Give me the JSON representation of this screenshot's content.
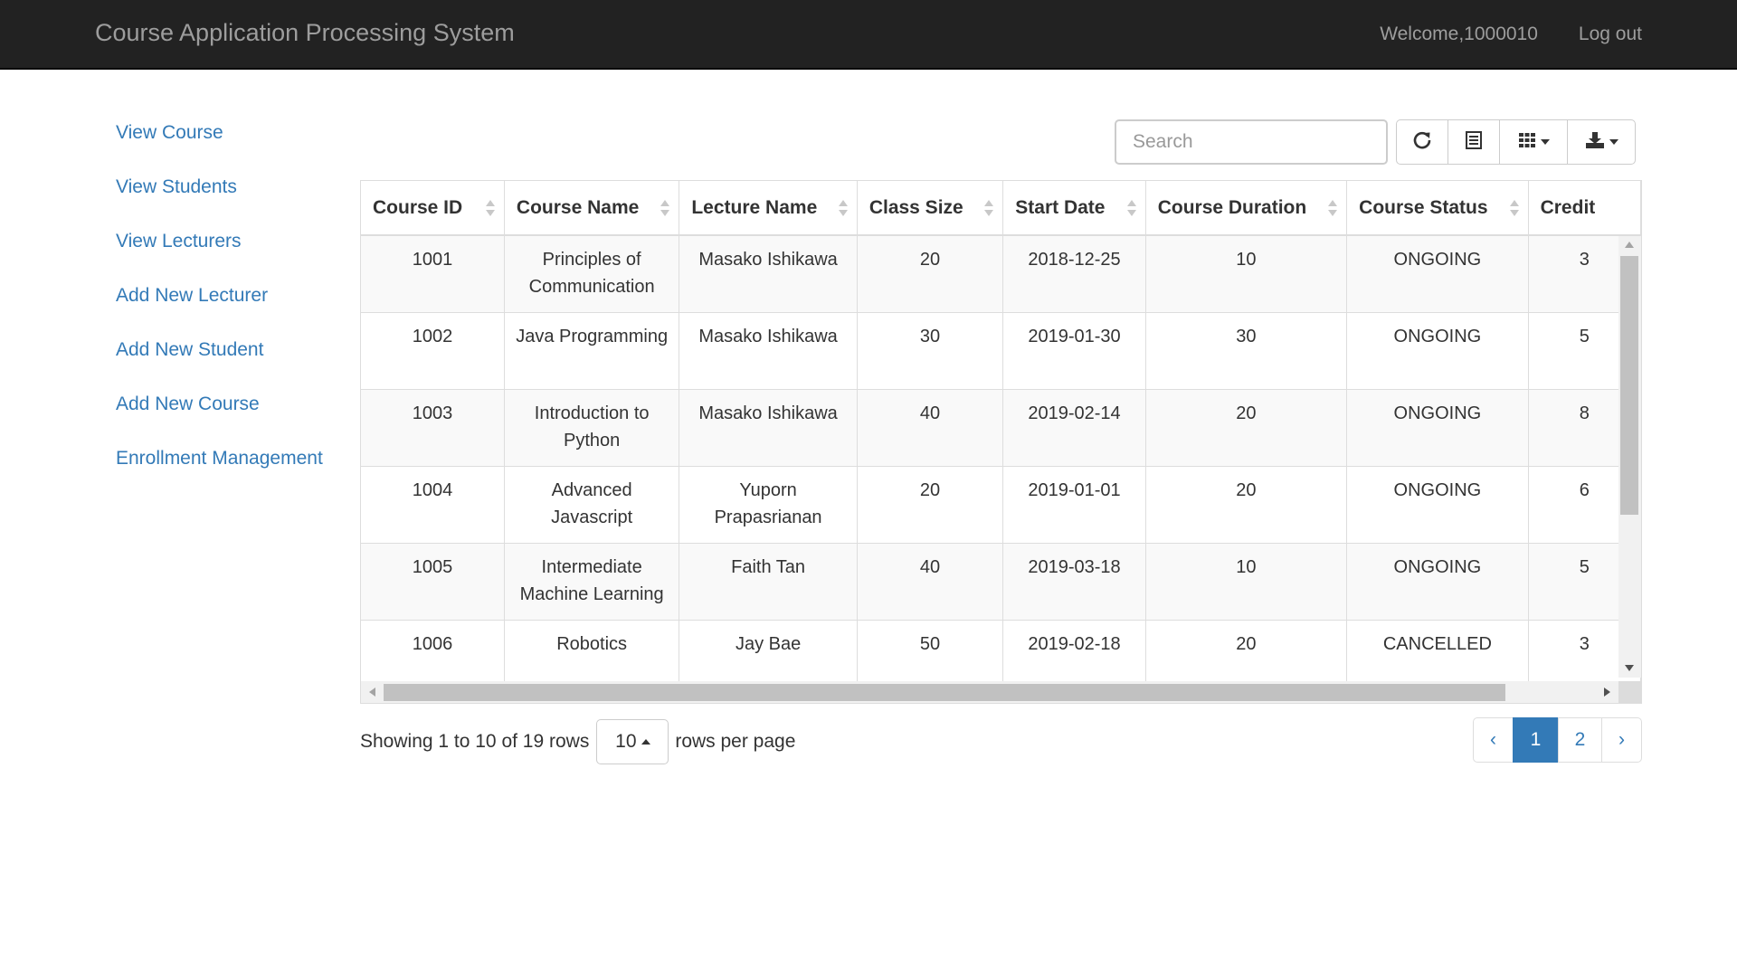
{
  "app": {
    "brand": "Course Application Processing System",
    "welcome": "Welcome,1000010",
    "logout": "Log out"
  },
  "sidebar": {
    "items": [
      {
        "label": "View Course"
      },
      {
        "label": "View Students"
      },
      {
        "label": "View Lecturers"
      },
      {
        "label": "Add New Lecturer"
      },
      {
        "label": "Add New Student"
      },
      {
        "label": "Add New Course"
      },
      {
        "label": "Enrollment Management"
      }
    ]
  },
  "toolbar": {
    "search_placeholder": "Search",
    "buttons": [
      {
        "icon": "refresh-icon"
      },
      {
        "icon": "list-view-icon"
      },
      {
        "icon": "columns-grid-icon"
      },
      {
        "icon": "export-icon"
      }
    ]
  },
  "table": {
    "columns": [
      "Course ID",
      "Course Name",
      "Lecture Name",
      "Class Size",
      "Start Date",
      "Course Duration",
      "Course Status",
      "Credit"
    ],
    "rows": [
      {
        "id": "1001",
        "name": "Principles of Communication",
        "lecturer": "Masako Ishikawa",
        "size": "20",
        "start": "2018-12-25",
        "duration": "10",
        "status": "ONGOING",
        "credit": "3"
      },
      {
        "id": "1002",
        "name": "Java Programming",
        "lecturer": "Masako Ishikawa",
        "size": "30",
        "start": "2019-01-30",
        "duration": "30",
        "status": "ONGOING",
        "credit": "5"
      },
      {
        "id": "1003",
        "name": "Introduction to Python",
        "lecturer": "Masako Ishikawa",
        "size": "40",
        "start": "2019-02-14",
        "duration": "20",
        "status": "ONGOING",
        "credit": "8"
      },
      {
        "id": "1004",
        "name": "Advanced Javascript",
        "lecturer": "Yuporn Prapasrianan",
        "size": "20",
        "start": "2019-01-01",
        "duration": "20",
        "status": "ONGOING",
        "credit": "6"
      },
      {
        "id": "1005",
        "name": "Intermediate Machine Learning",
        "lecturer": "Faith Tan",
        "size": "40",
        "start": "2019-03-18",
        "duration": "10",
        "status": "ONGOING",
        "credit": "5"
      },
      {
        "id": "1006",
        "name": "Robotics",
        "lecturer": "Jay Bae",
        "size": "50",
        "start": "2019-02-18",
        "duration": "20",
        "status": "CANCELLED",
        "credit": "3"
      }
    ]
  },
  "pagination": {
    "info": "Showing 1 to 10 of 19 rows",
    "page_size": "10",
    "per_page_label": "rows per page",
    "prev": "‹",
    "pages": [
      "1",
      "2"
    ],
    "next": "›",
    "active_page": "1"
  },
  "colors": {
    "navbar": "#222222",
    "link": "#337ab7",
    "active_page": "#337ab7"
  }
}
